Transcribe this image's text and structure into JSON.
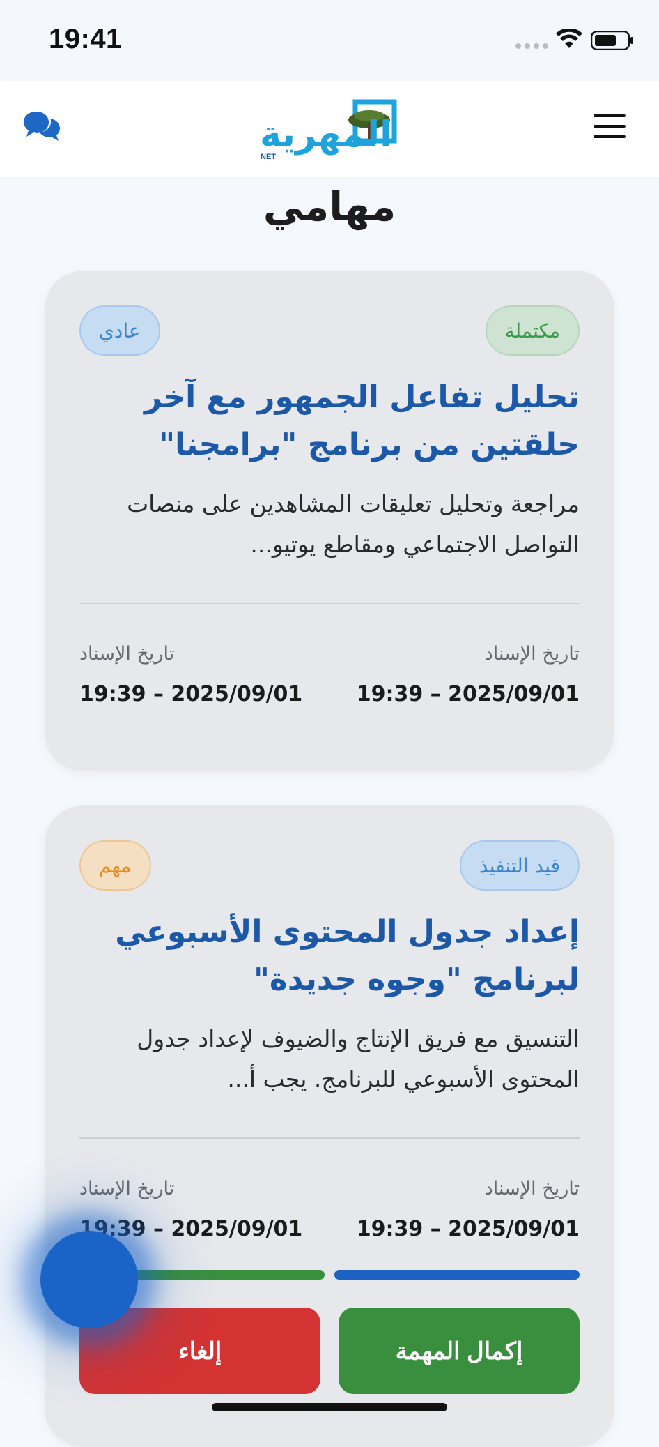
{
  "status_bar": {
    "time": "19:41",
    "icons": [
      "cellular-signal-icon",
      "wifi-icon",
      "battery-icon"
    ]
  },
  "header": {
    "left_icon": "chat-icon",
    "right_icon": "hamburger-menu-icon",
    "logo": {
      "text": "المهرية",
      "sub": "NET"
    }
  },
  "page": {
    "title": "مهامي"
  },
  "colors": {
    "title_blue": "#1c58a8",
    "success_green": "#3a8f3e",
    "danger_red": "#d33333",
    "progress_blue": "#1c62c2",
    "fab_blue": "#1a64c8"
  },
  "tasks": [
    {
      "status": "مكتملة",
      "priority": "عادي",
      "title": "تحليل تفاعل الجمهور مع آخر حلقتين من برنامج \"برامجنا\"",
      "description": "مراجعة وتحليل تعليقات المشاهدين على منصات التواصل الاجتماعي ومقاطع يوتيو...",
      "date_right": {
        "label": "تاريخ الإسناد",
        "value": "19:39 – 2025/09/01"
      },
      "date_left": {
        "label": "تاريخ الإسناد",
        "value": "19:39 – 2025/09/01"
      }
    },
    {
      "status": "قيد التنفيذ",
      "priority": "مهم",
      "title": "إعداد جدول المحتوى الأسبوعي لبرنامج \"وجوه جديدة\"",
      "description": "التنسيق مع فريق الإنتاج والضيوف لإعداد جدول المحتوى الأسبوعي للبرنامج. يجب أ...",
      "date_right": {
        "label": "تاريخ الإسناد",
        "value": "19:39 – 2025/09/01"
      },
      "date_left": {
        "label": "تاريخ الإسناد",
        "value": "19:39 – 2025/09/01"
      },
      "actions": {
        "complete": "إكمال المهمة",
        "cancel": "إلغاء"
      }
    }
  ]
}
